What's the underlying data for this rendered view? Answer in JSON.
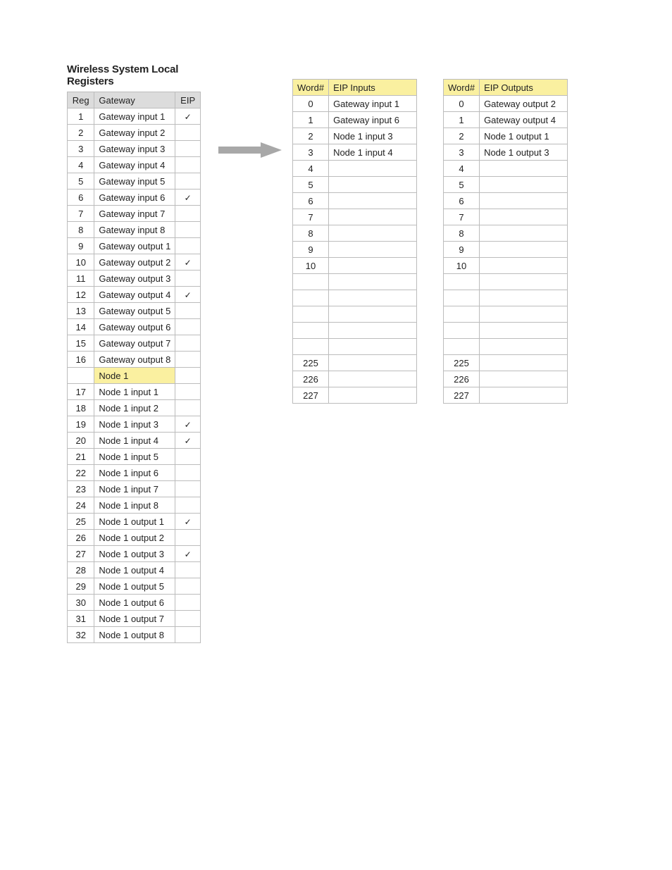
{
  "title": "Wireless System Local Registers",
  "checkmark": "✓",
  "local_registers": {
    "headers": {
      "reg": "Reg",
      "name": "Gateway",
      "eip": "EIP"
    },
    "rows": [
      {
        "reg": "1",
        "name": "Gateway input 1",
        "eip": true
      },
      {
        "reg": "2",
        "name": "Gateway input 2",
        "eip": false
      },
      {
        "reg": "3",
        "name": "Gateway input 3",
        "eip": false
      },
      {
        "reg": "4",
        "name": "Gateway input 4",
        "eip": false
      },
      {
        "reg": "5",
        "name": "Gateway input 5",
        "eip": false
      },
      {
        "reg": "6",
        "name": "Gateway input 6",
        "eip": true
      },
      {
        "reg": "7",
        "name": "Gateway input 7",
        "eip": false
      },
      {
        "reg": "8",
        "name": "Gateway input 8",
        "eip": false
      },
      {
        "reg": "9",
        "name": "Gateway output 1",
        "eip": false
      },
      {
        "reg": "10",
        "name": "Gateway output 2",
        "eip": true
      },
      {
        "reg": "11",
        "name": "Gateway output 3",
        "eip": false
      },
      {
        "reg": "12",
        "name": "Gateway output 4",
        "eip": true
      },
      {
        "reg": "13",
        "name": "Gateway output 5",
        "eip": false
      },
      {
        "reg": "14",
        "name": "Gateway output 6",
        "eip": false
      },
      {
        "reg": "15",
        "name": "Gateway output 7",
        "eip": false
      },
      {
        "reg": "16",
        "name": "Gateway output 8",
        "eip": false
      }
    ],
    "subheader": {
      "name": "Node 1"
    },
    "rows2": [
      {
        "reg": "17",
        "name": "Node 1 input 1",
        "eip": false
      },
      {
        "reg": "18",
        "name": "Node 1 input 2",
        "eip": false
      },
      {
        "reg": "19",
        "name": "Node 1 input 3",
        "eip": true
      },
      {
        "reg": "20",
        "name": "Node 1 input 4",
        "eip": true
      },
      {
        "reg": "21",
        "name": "Node 1 input 5",
        "eip": false
      },
      {
        "reg": "22",
        "name": "Node 1 input 6",
        "eip": false
      },
      {
        "reg": "23",
        "name": "Node 1 input 7",
        "eip": false
      },
      {
        "reg": "24",
        "name": "Node 1 input 8",
        "eip": false
      },
      {
        "reg": "25",
        "name": "Node 1 output 1",
        "eip": true
      },
      {
        "reg": "26",
        "name": "Node 1 output 2",
        "eip": false
      },
      {
        "reg": "27",
        "name": "Node 1 output 3",
        "eip": true
      },
      {
        "reg": "28",
        "name": "Node 1 output 4",
        "eip": false
      },
      {
        "reg": "29",
        "name": "Node 1 output 5",
        "eip": false
      },
      {
        "reg": "30",
        "name": "Node 1 output 6",
        "eip": false
      },
      {
        "reg": "31",
        "name": "Node 1 output 7",
        "eip": false
      },
      {
        "reg": "32",
        "name": "Node 1 output 8",
        "eip": false
      }
    ]
  },
  "eip_inputs": {
    "headers": {
      "word": "Word#",
      "name": "EIP Inputs"
    },
    "rows": [
      {
        "word": "0",
        "name": "Gateway input 1"
      },
      {
        "word": "1",
        "name": "Gateway input 6"
      },
      {
        "word": "2",
        "name": "Node 1 input 3"
      },
      {
        "word": "3",
        "name": "Node 1 input 4"
      },
      {
        "word": "4",
        "name": ""
      },
      {
        "word": "5",
        "name": ""
      },
      {
        "word": "6",
        "name": ""
      },
      {
        "word": "7",
        "name": ""
      },
      {
        "word": "8",
        "name": ""
      },
      {
        "word": "9",
        "name": ""
      },
      {
        "word": "10",
        "name": ""
      },
      {
        "word": "",
        "name": ""
      },
      {
        "word": "",
        "name": ""
      },
      {
        "word": "",
        "name": ""
      },
      {
        "word": "",
        "name": ""
      },
      {
        "word": "",
        "name": ""
      },
      {
        "word": "225",
        "name": ""
      },
      {
        "word": "226",
        "name": ""
      },
      {
        "word": "227",
        "name": ""
      }
    ]
  },
  "eip_outputs": {
    "headers": {
      "word": "Word#",
      "name": "EIP Outputs"
    },
    "rows": [
      {
        "word": "0",
        "name": "Gateway output 2"
      },
      {
        "word": "1",
        "name": "Gateway output 4"
      },
      {
        "word": "2",
        "name": "Node 1 output 1"
      },
      {
        "word": "3",
        "name": "Node 1 output 3"
      },
      {
        "word": "4",
        "name": ""
      },
      {
        "word": "5",
        "name": ""
      },
      {
        "word": "6",
        "name": ""
      },
      {
        "word": "7",
        "name": ""
      },
      {
        "word": "8",
        "name": ""
      },
      {
        "word": "9",
        "name": ""
      },
      {
        "word": "10",
        "name": ""
      },
      {
        "word": "",
        "name": ""
      },
      {
        "word": "",
        "name": ""
      },
      {
        "word": "",
        "name": ""
      },
      {
        "word": "",
        "name": ""
      },
      {
        "word": "",
        "name": ""
      },
      {
        "word": "225",
        "name": ""
      },
      {
        "word": "226",
        "name": ""
      },
      {
        "word": "227",
        "name": ""
      }
    ]
  }
}
